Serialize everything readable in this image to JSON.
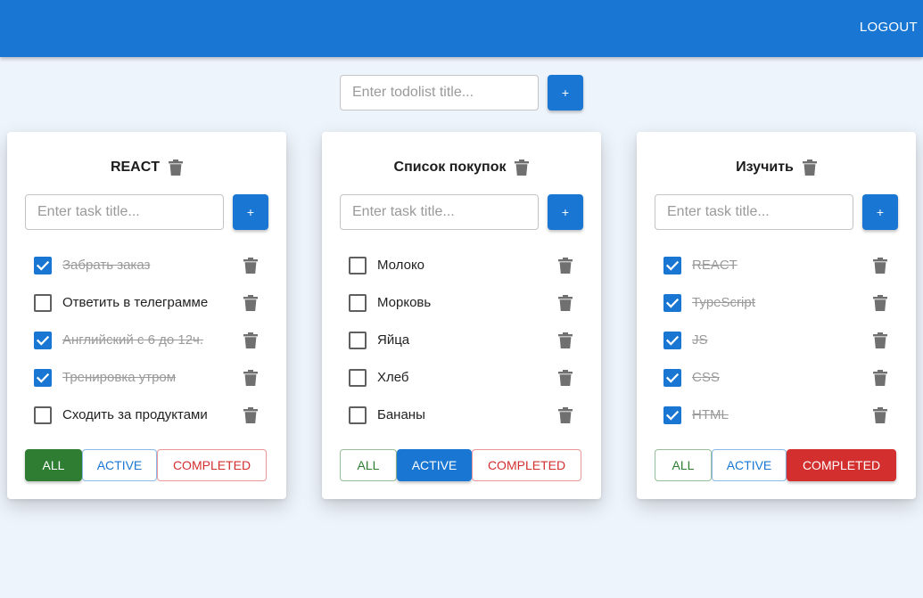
{
  "appbar": {
    "logout_label": "LOGOUT"
  },
  "add_todolist": {
    "placeholder": "Enter todolist title...",
    "button_label": "+"
  },
  "colors": {
    "primary": "#1976d2",
    "success": "#2e7d32",
    "error": "#d32f2f",
    "background": "#eef4fb"
  },
  "icons": {
    "delete": "trash-icon",
    "done": "check-icon"
  },
  "todolists": [
    {
      "title": "REACT",
      "task_placeholder": "Enter task title...",
      "add_label": "+",
      "tasks": [
        {
          "title": "Забрать заказ",
          "done": true
        },
        {
          "title": "Ответить в телеграмме",
          "done": false
        },
        {
          "title": "Английский с 6 до 12ч.",
          "done": true
        },
        {
          "title": "Тренировка утром",
          "done": true
        },
        {
          "title": "Сходить за продуктами",
          "done": false
        }
      ],
      "filters": {
        "all": "ALL",
        "active": "ACTIVE",
        "completed": "COMPLETED"
      },
      "selected_filter": "all"
    },
    {
      "title": "Список покупок",
      "task_placeholder": "Enter task title...",
      "add_label": "+",
      "tasks": [
        {
          "title": "Молоко",
          "done": false
        },
        {
          "title": "Морковь",
          "done": false
        },
        {
          "title": "Яйца",
          "done": false
        },
        {
          "title": "Хлеб",
          "done": false
        },
        {
          "title": "Бананы",
          "done": false
        }
      ],
      "filters": {
        "all": "ALL",
        "active": "ACTIVE",
        "completed": "COMPLETED"
      },
      "selected_filter": "active"
    },
    {
      "title": "Изучить",
      "task_placeholder": "Enter task title...",
      "add_label": "+",
      "tasks": [
        {
          "title": "REACT",
          "done": true
        },
        {
          "title": "TypeScript",
          "done": true
        },
        {
          "title": "JS",
          "done": true
        },
        {
          "title": "CSS",
          "done": true
        },
        {
          "title": "HTML",
          "done": true
        }
      ],
      "filters": {
        "all": "ALL",
        "active": "ACTIVE",
        "completed": "COMPLETED"
      },
      "selected_filter": "completed"
    }
  ]
}
